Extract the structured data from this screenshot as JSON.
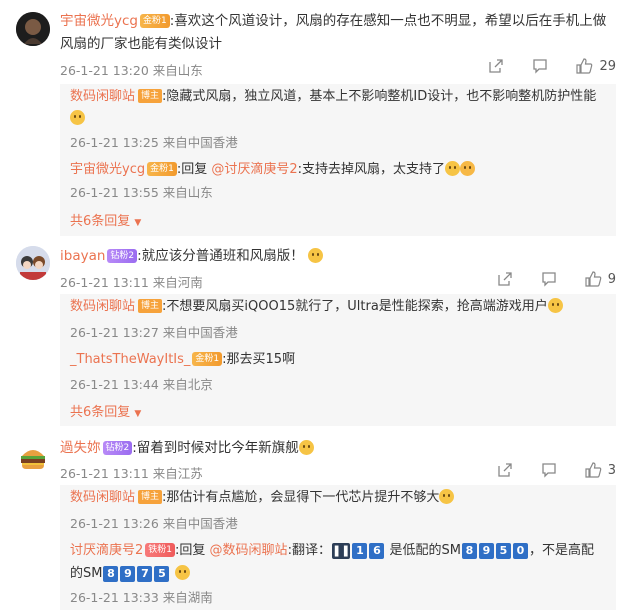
{
  "comments": [
    {
      "user": "宇宙微光ycg",
      "badge": "金粉1",
      "text": ":喜欢这个风道设计，风扇的存在感知一点也不明显，希望以后在手机上做风扇的厂家也能有类似设计",
      "time": "26-1-21 13:20 来自山东",
      "likes": "29",
      "replies": [
        {
          "user": "数码闲聊站",
          "badge": "博主",
          "text": ":隐藏式风扇，独立风道，基本上不影响整机ID设计，也不影响整机防护性能",
          "time": "26-1-21 13:25 来自中国香港"
        },
        {
          "user": "宇宙微光ycg",
          "badge": "金粉1",
          "text_prefix": ":回复",
          "mention": "@讨厌滴庚号2",
          "text": ":支持去掉风扇，太支持了",
          "time": "26-1-21 13:55 来自山东"
        }
      ],
      "more": "共6条回复"
    },
    {
      "user": "ibayan",
      "badge": "钻粉2",
      "text": ":就应该分普通班和风扇版！",
      "time": "26-1-21 13:11 来自河南",
      "likes": "9",
      "replies": [
        {
          "user": "数码闲聊站",
          "badge": "博主",
          "text": ":不想要风扇买iQOO15就行了，Ultra是性能探索，抢高端游戏用户",
          "time": "26-1-21 13:27 来自中国香港"
        },
        {
          "user": "_ThatsTheWayItIs_",
          "badge": "金粉1",
          "text": ":那去买15啊",
          "time": "26-1-21 13:44 来自北京"
        }
      ],
      "more": "共6条回复"
    },
    {
      "user": "過失妳",
      "badge": "钻粉2",
      "text": ":留着到时候对比今年新旗舰",
      "time": "26-1-21 13:11 来自江苏",
      "likes": "3",
      "replies": [
        {
          "user": "数码闲聊站",
          "badge": "博主",
          "text": ":那估计有点尴尬，会显得下一代芯片提升不够大",
          "time": "26-1-21 13:26 来自中国香港"
        },
        {
          "user": "讨厌滴庚号2",
          "badge": "铁粉1",
          "text_prefix": ":回复",
          "mention": "@数码闲聊站",
          "text_a": ":翻译：",
          "keys_a": [
            "1",
            "6"
          ],
          "text_b": "是低配的SM",
          "keys_b": [
            "8",
            "9",
            "5",
            "0"
          ],
          "text_c": "，不是高配的SM",
          "keys_c": [
            "8",
            "9",
            "7",
            "5"
          ],
          "time": "26-1-21 13:33 来自湖南"
        }
      ]
    }
  ],
  "icons": [
    "share-icon",
    "comment-icon",
    "like-icon"
  ],
  "colors": {
    "username": "#eb7350",
    "meta": "#888888",
    "reply_bg": "#f6f6f6"
  }
}
